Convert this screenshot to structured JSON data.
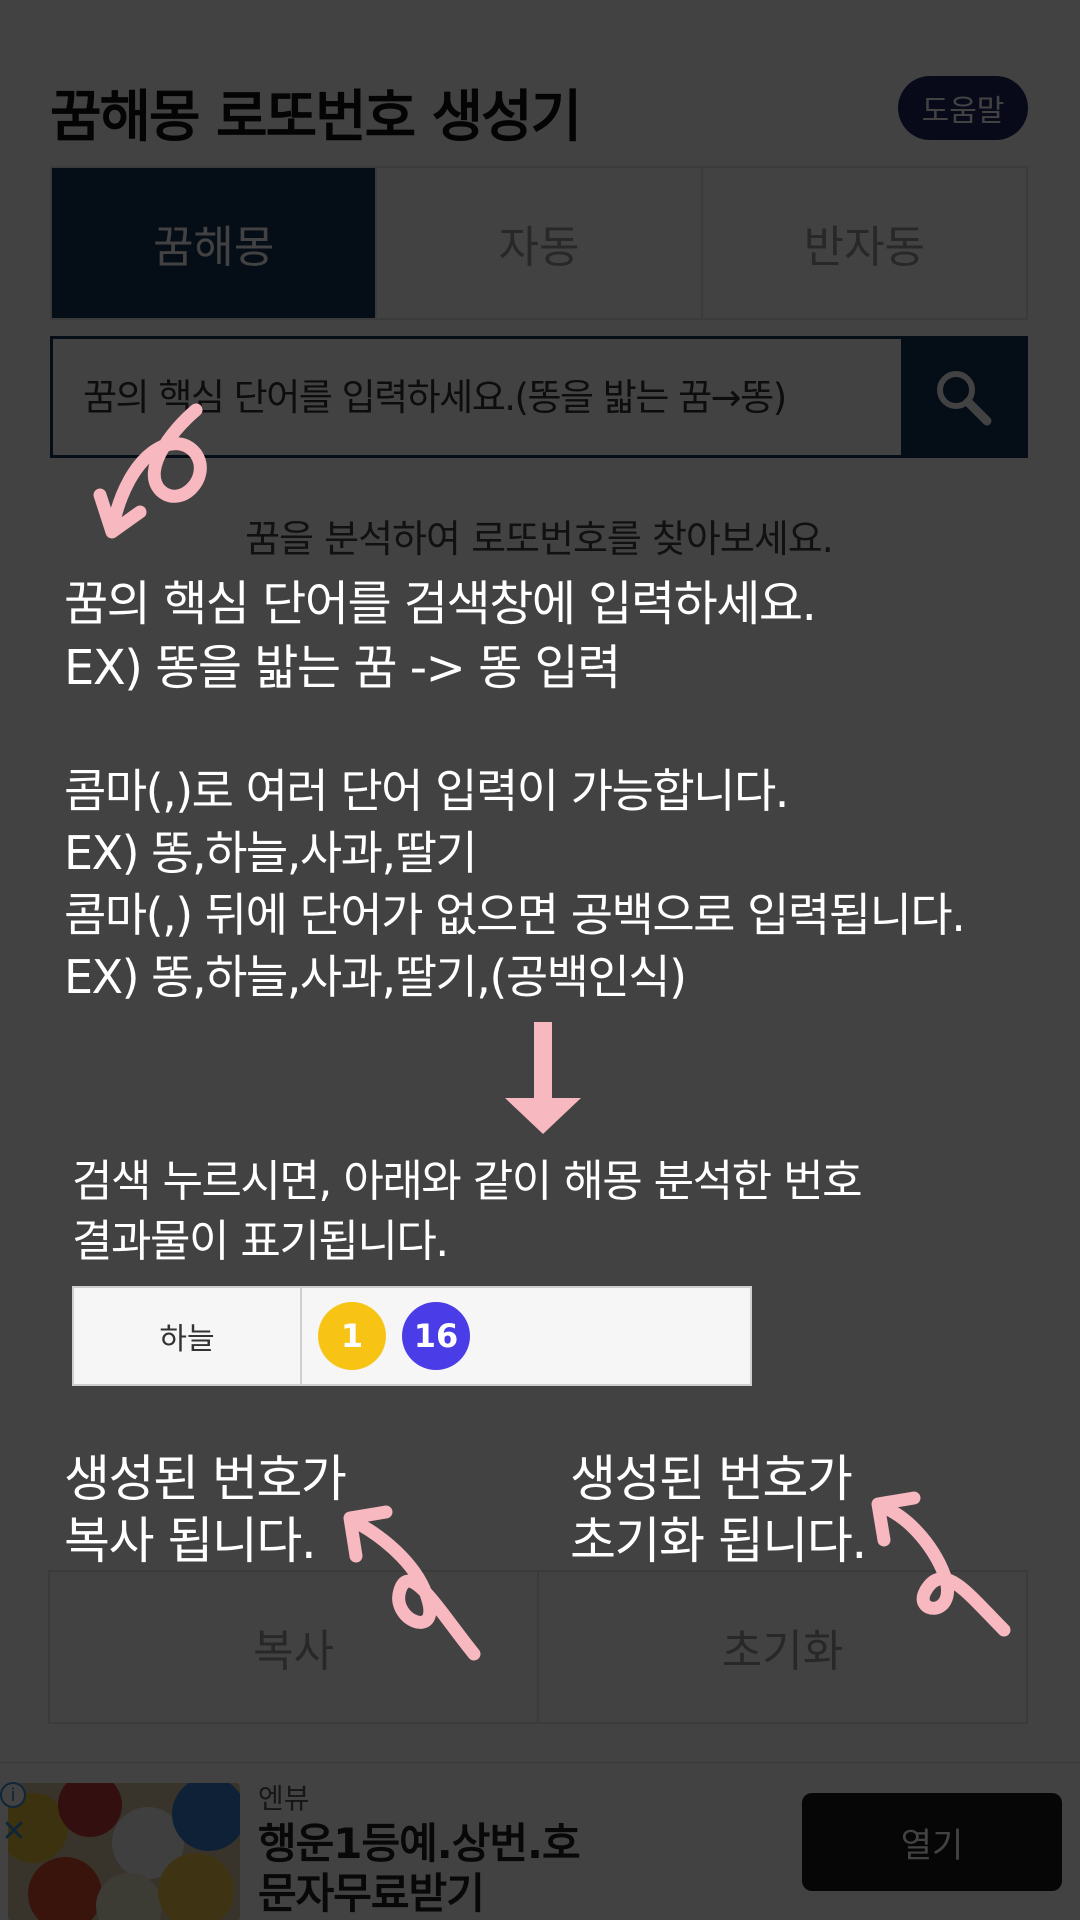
{
  "app": {
    "title": "꿈해몽 로또번호 생성기",
    "help_label": "도움말"
  },
  "tabs": [
    {
      "label": "꿈해몽",
      "active": true
    },
    {
      "label": "자동",
      "active": false
    },
    {
      "label": "반자동",
      "active": false
    }
  ],
  "search": {
    "placeholder": "꿈의 핵심 단어를 입력하세요.(똥을 밟는 꿈→똥)",
    "button_icon": "search-icon"
  },
  "description": {
    "line1": "꿈을 분석하여 로또번호를 찾아보세요."
  },
  "bottom_buttons": {
    "copy_label": "복사",
    "reset_label": "초기화"
  },
  "tutorial": {
    "step1_line1": "꿈의 핵심 단어를 검색창에 입력하세요.",
    "step1_line2": "EX) 똥을 밟는 꿈 -> 똥 입력",
    "step2_line1": "콤마(,)로 여러 단어 입력이 가능합니다.",
    "step2_line2": "EX) 똥,하늘,사과,딸기",
    "step2_line3": "콤마(,) 뒤에 단어가 없으면 공백으로 입력됩니다.",
    "step2_line4": "EX) 똥,하늘,사과,딸기,(공백인식)",
    "step3_line1": "검색 누르시면, 아래와 같이 해몽 분석한 번호",
    "step3_line2": "결과물이 표기됩니다.",
    "copy_note_line1": "생성된 번호가",
    "copy_note_line2": "복사 됩니다.",
    "reset_note_line1": "생성된 번호가",
    "reset_note_line2": "초기화 됩니다."
  },
  "example_result": {
    "keyword": "하늘",
    "balls": [
      {
        "number": "1",
        "color": "#f7c416"
      },
      {
        "number": "16",
        "color": "#4a3ce6"
      }
    ]
  },
  "ad": {
    "advertiser": "엔뷰",
    "headline_line1": "행운1등예.상번.호",
    "headline_line2": "문자무료받기",
    "open_label": "열기",
    "info_icon": "info-icon",
    "close_icon": "close-icon"
  },
  "colors": {
    "primary_navy": "#15335a",
    "help_button": "#1f2a66",
    "overlay_arrow_pink": "#f7b8bf",
    "overlay": "rgba(0,0,0,0.74)"
  }
}
